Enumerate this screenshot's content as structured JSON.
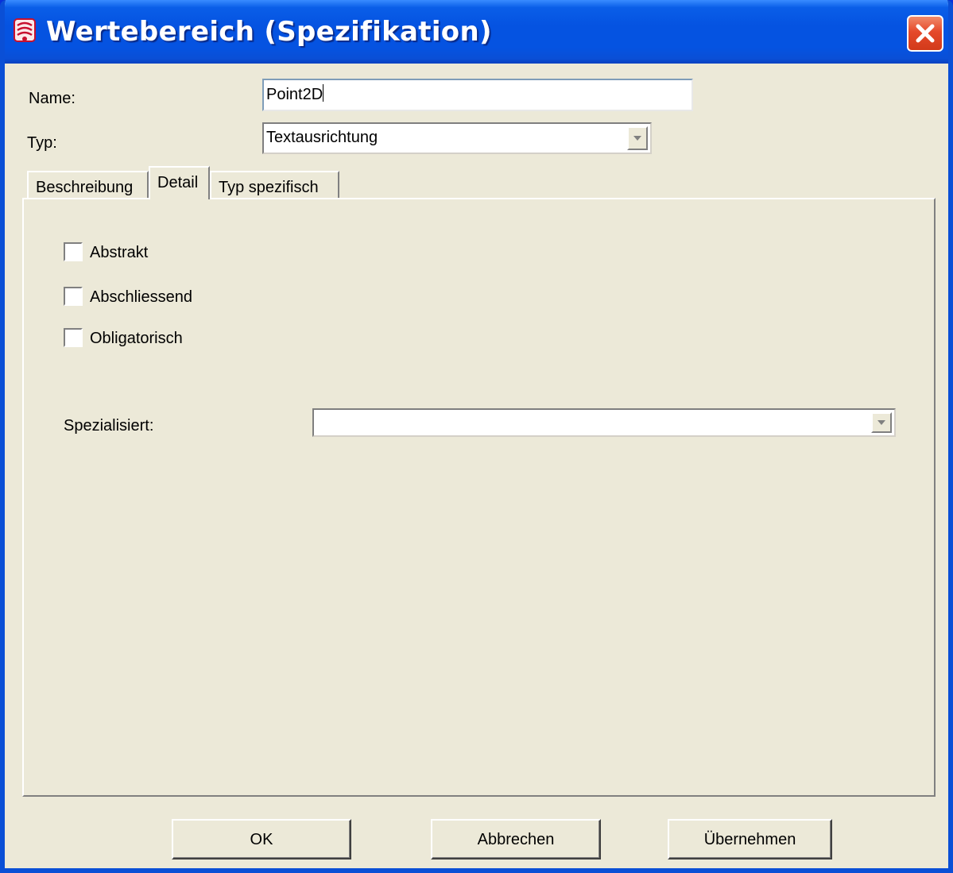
{
  "window": {
    "title": "Wertebereich (Spezifikation)",
    "icon": "app-icon",
    "accent": "#0553e1",
    "close_color": "#e5492a"
  },
  "form": {
    "name_label": "Name:",
    "name_value": "Point2D",
    "type_label": "Typ:",
    "type_value": "Textausrichtung"
  },
  "tabs": [
    {
      "label": "Beschreibung",
      "active": false
    },
    {
      "label": "Detail",
      "active": true
    },
    {
      "label": "Typ spezifisch",
      "active": false
    }
  ],
  "detail": {
    "checkboxes": [
      {
        "label": "Abstrakt",
        "checked": false
      },
      {
        "label": "Abschliessend",
        "checked": false
      },
      {
        "label": "Obligatorisch",
        "checked": false
      }
    ],
    "specialized_label": "Spezialisiert:",
    "specialized_value": ""
  },
  "buttons": {
    "ok": "OK",
    "cancel": "Abbrechen",
    "apply": "Übernehmen"
  }
}
